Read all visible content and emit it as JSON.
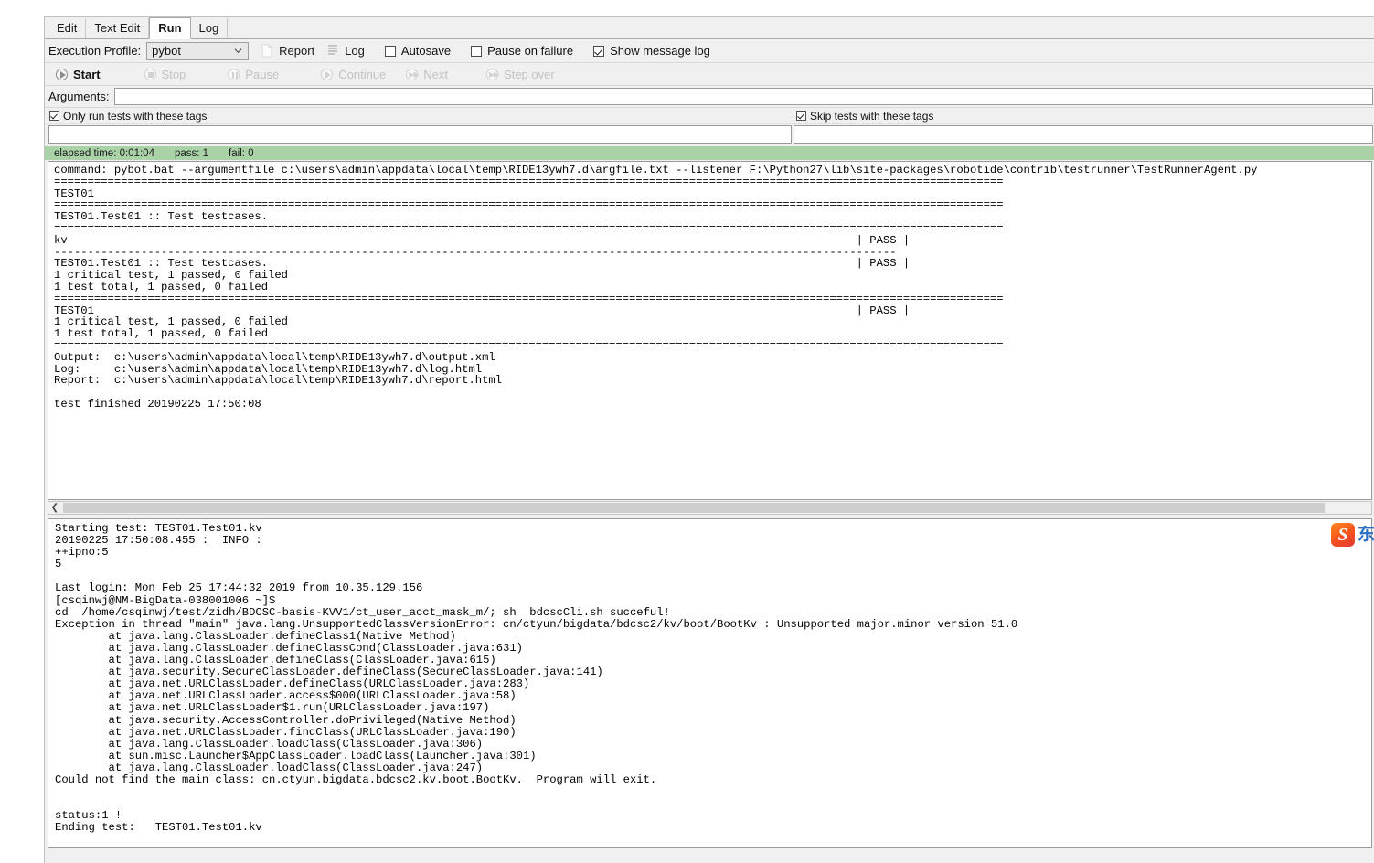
{
  "tabs": [
    {
      "label": "Edit",
      "active": false
    },
    {
      "label": "Text Edit",
      "active": false
    },
    {
      "label": "Run",
      "active": true
    },
    {
      "label": "Log",
      "active": false
    }
  ],
  "toolbar": {
    "execution_profile_label": "Execution Profile:",
    "execution_profile_value": "pybot",
    "report_label": "Report",
    "log_label": "Log",
    "autosave_label": "Autosave",
    "autosave_checked": false,
    "pause_on_failure_label": "Pause on failure",
    "pause_on_failure_checked": false,
    "show_message_log_label": "Show message log",
    "show_message_log_checked": true
  },
  "run_controls": [
    {
      "label": "Start",
      "enabled": true,
      "icon": "play-icon"
    },
    {
      "label": "Stop",
      "enabled": false,
      "icon": "stop-icon"
    },
    {
      "label": "Pause",
      "enabled": false,
      "icon": "pause-icon"
    },
    {
      "label": "Continue",
      "enabled": false,
      "icon": "play-icon"
    },
    {
      "label": "Next",
      "enabled": false,
      "icon": "next-icon"
    },
    {
      "label": "Step over",
      "enabled": false,
      "icon": "step-over-icon"
    }
  ],
  "arguments": {
    "label": "Arguments:",
    "value": "",
    "placeholder": ""
  },
  "tags": {
    "include_label": "Only run tests with these tags",
    "include_checked": true,
    "include_value": "",
    "exclude_label": "Skip tests with these tags",
    "exclude_checked": true,
    "exclude_value": ""
  },
  "status": {
    "elapsed_label": "elapsed time: 0:01:04",
    "pass_label": "pass: 1",
    "fail_label": "fail: 0"
  },
  "console_lines": [
    "command: pybot.bat --argumentfile c:\\users\\admin\\appdata\\local\\temp\\RIDE13ywh7.d\\argfile.txt --listener F:\\Python27\\lib\\site-packages\\robotide\\contrib\\testrunner\\TestRunnerAgent.py",
    "==============================================================================================================================================",
    "TEST01",
    "==============================================================================================================================================",
    "TEST01.Test01 :: Test testcases.",
    "==============================================================================================================================================",
    "kv                                                                                                                      | PASS |",
    "------------------------------------------------------------------------------------------------------------------------------",
    "TEST01.Test01 :: Test testcases.                                                                                        | PASS |",
    "1 critical test, 1 passed, 0 failed",
    "1 test total, 1 passed, 0 failed",
    "==============================================================================================================================================",
    "TEST01                                                                                                                  | PASS |",
    "1 critical test, 1 passed, 0 failed",
    "1 test total, 1 passed, 0 failed",
    "==============================================================================================================================================",
    "Output:  c:\\users\\admin\\appdata\\local\\temp\\RIDE13ywh7.d\\output.xml",
    "Log:     c:\\users\\admin\\appdata\\local\\temp\\RIDE13ywh7.d\\log.html",
    "Report:  c:\\users\\admin\\appdata\\local\\temp\\RIDE13ywh7.d\\report.html",
    "",
    "test finished 20190225 17:50:08"
  ],
  "message_log_lines": [
    "Starting test: TEST01.Test01.kv",
    "20190225 17:50:08.455 :  INFO :",
    "++ipno:5",
    "5",
    "",
    "Last login: Mon Feb 25 17:44:32 2019 from 10.35.129.156",
    "[csqinwj@NM-BigData-038001006 ~]$",
    "cd  /home/csqinwj/test/zidh/BDCSC-basis-KVV1/ct_user_acct_mask_m/; sh  bdcscCli.sh succeful!",
    "Exception in thread \"main\" java.lang.UnsupportedClassVersionError: cn/ctyun/bigdata/bdcsc2/kv/boot/BootKv : Unsupported major.minor version 51.0",
    "        at java.lang.ClassLoader.defineClass1(Native Method)",
    "        at java.lang.ClassLoader.defineClassCond(ClassLoader.java:631)",
    "        at java.lang.ClassLoader.defineClass(ClassLoader.java:615)",
    "        at java.security.SecureClassLoader.defineClass(SecureClassLoader.java:141)",
    "        at java.net.URLClassLoader.defineClass(URLClassLoader.java:283)",
    "        at java.net.URLClassLoader.access$000(URLClassLoader.java:58)",
    "        at java.net.URLClassLoader$1.run(URLClassLoader.java:197)",
    "        at java.security.AccessController.doPrivileged(Native Method)",
    "        at java.net.URLClassLoader.findClass(URLClassLoader.java:190)",
    "        at java.lang.ClassLoader.loadClass(ClassLoader.java:306)",
    "        at sun.misc.Launcher$AppClassLoader.loadClass(Launcher.java:301)",
    "        at java.lang.ClassLoader.loadClass(ClassLoader.java:247)",
    "Could not find the main class: cn.ctyun.bigdata.bdcsc2.kv.boot.BootKv.  Program will exit.",
    "",
    "",
    "status:1 !",
    "Ending test:   TEST01.Test01.kv"
  ],
  "watermark": {
    "badge": "S",
    "text": "东"
  },
  "colors": {
    "status_bar": "#a9d3a7",
    "panel": "#f0f0f0",
    "accent": "#2a6fc4"
  }
}
